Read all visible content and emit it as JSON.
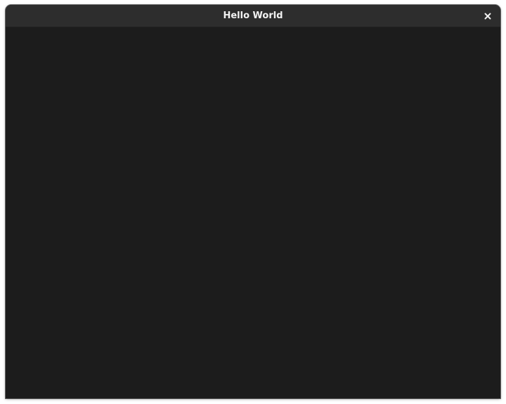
{
  "window": {
    "title": "Hello World",
    "close_icon": "close-icon"
  },
  "colors": {
    "titlebar": "#2d2d2d",
    "content_background": "#1c1c1c",
    "title_text": "#f2f2f2"
  }
}
